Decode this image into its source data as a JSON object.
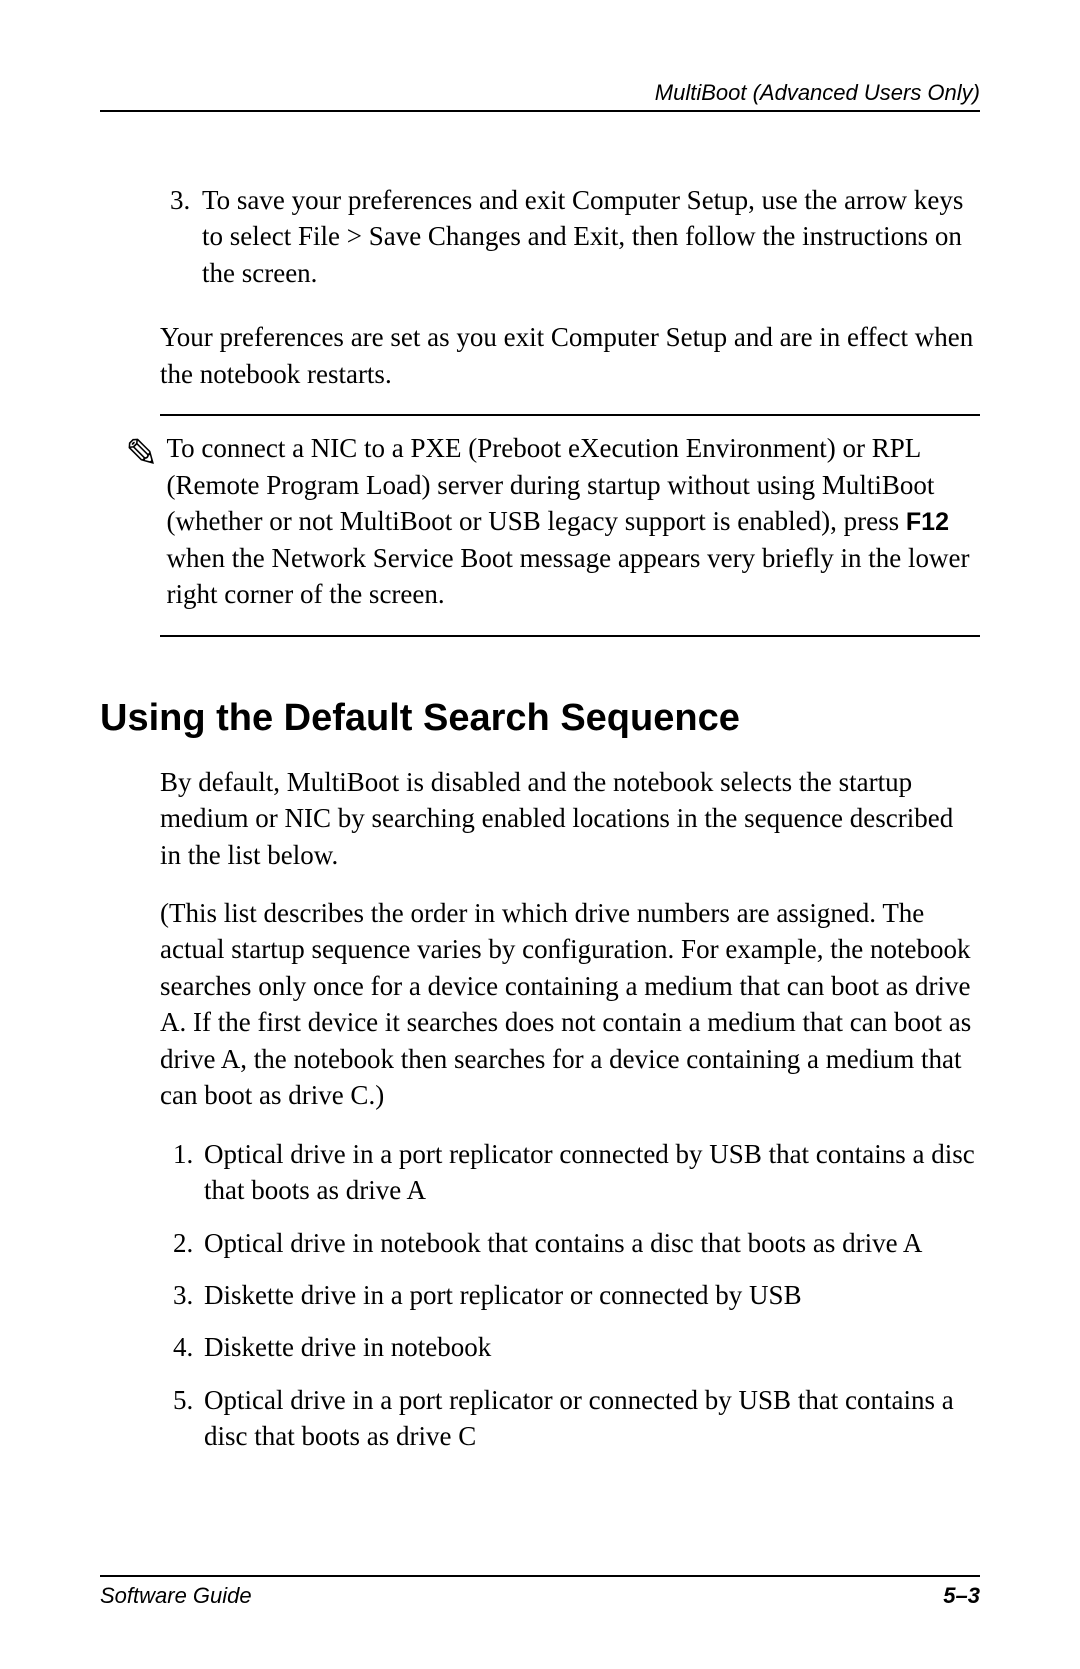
{
  "header": {
    "right": "MultiBoot (Advanced Users Only)"
  },
  "step3": {
    "number": "3.",
    "text": "To save your preferences and exit Computer Setup, use the arrow keys to select File > Save Changes and Exit, then follow the instructions on the screen."
  },
  "prefs_sentence": "Your preferences are set as you exit Computer Setup and are in effect when the notebook restarts.",
  "note": {
    "before": "To connect a NIC to a PXE (Preboot eXecution Environment) or RPL (Remote Program Load) server during startup without using MultiBoot (whether or not MultiBoot or USB legacy support is enabled), press ",
    "key": "F12",
    "after": " when the Network Service Boot message appears very briefly in the lower right corner of the screen."
  },
  "heading": "Using the Default Search Sequence",
  "para1": "By default, MultiBoot is disabled and the notebook selects the startup medium or NIC by searching enabled locations in the sequence described in the list below.",
  "para2": "(This list describes the order in which drive numbers are assigned. The actual startup sequence varies by configuration. For example, the notebook searches only once for a device containing a medium that can boot as drive A. If the first device it searches does not contain a medium that can boot as drive A, the notebook then searches for a device containing a medium that can boot as drive C.)",
  "sequence": [
    "Optical drive in a port replicator connected by USB that contains a disc that boots as drive A",
    "Optical drive in notebook that contains a disc that boots as drive A",
    "Diskette drive in a port replicator or connected by USB",
    "Diskette drive in notebook",
    "Optical drive in a port replicator or connected by USB that contains a disc that boots as drive C"
  ],
  "footer": {
    "left": "Software Guide",
    "right": "5–3"
  }
}
